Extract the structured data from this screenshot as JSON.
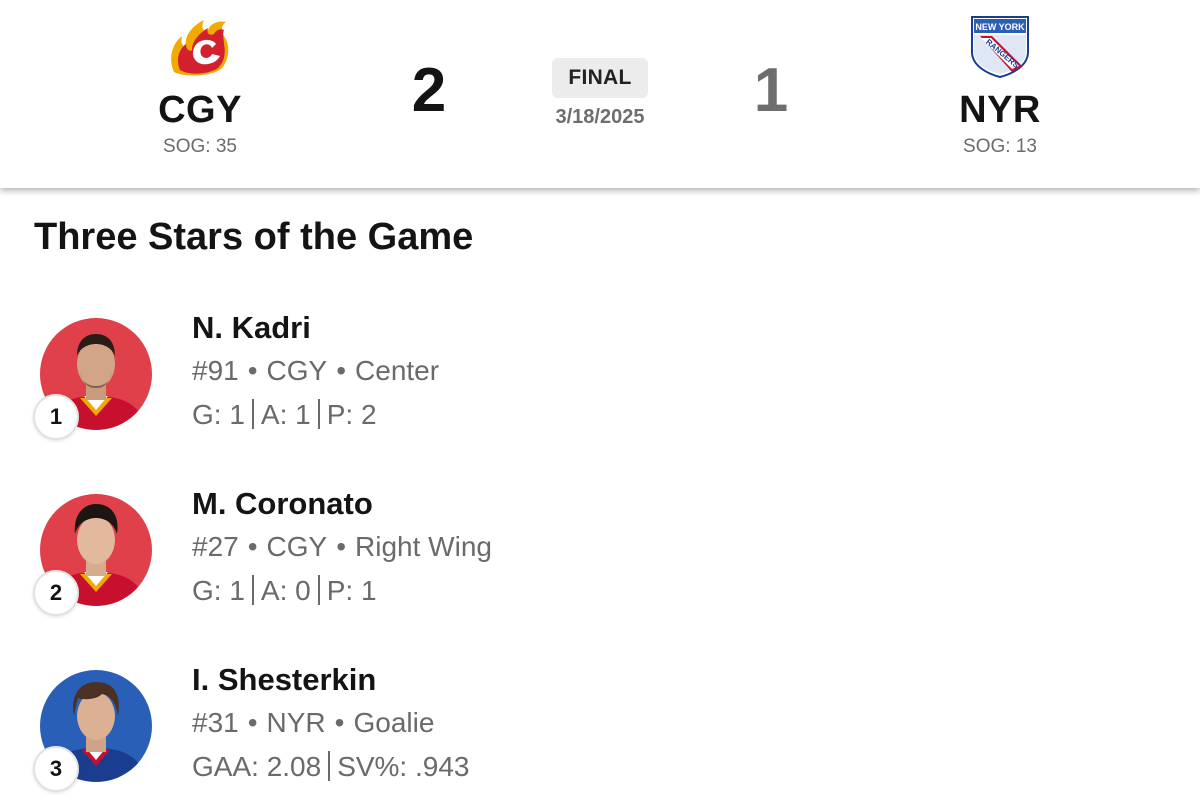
{
  "game": {
    "status": "FINAL",
    "date": "3/18/2025",
    "home": {
      "abbr": "CGY",
      "score": "2",
      "sog": "SOG: 35",
      "logo": "flames-logo",
      "color": "#c8102e"
    },
    "away": {
      "abbr": "NYR",
      "score": "1",
      "sog": "SOG: 13",
      "logo": "rangers-logo",
      "color": "#0038a8"
    }
  },
  "section_title": "Three Stars of the Game",
  "stars": [
    {
      "rank": "1",
      "name": "N. Kadri",
      "number": "#91",
      "team": "CGY",
      "position": "Center",
      "stats": [
        "G: 1",
        "A: 1",
        "P: 2"
      ],
      "bg_color": "#e0404a"
    },
    {
      "rank": "2",
      "name": "M. Coronato",
      "number": "#27",
      "team": "CGY",
      "position": "Right Wing",
      "stats": [
        "G: 1",
        "A: 0",
        "P: 1"
      ],
      "bg_color": "#e0404a"
    },
    {
      "rank": "3",
      "name": "I. Shesterkin",
      "number": "#31",
      "team": "NYR",
      "position": "Goalie",
      "stats": [
        "GAA: 2.08",
        "SV%: .943"
      ],
      "bg_color": "#2a5fb8"
    }
  ]
}
